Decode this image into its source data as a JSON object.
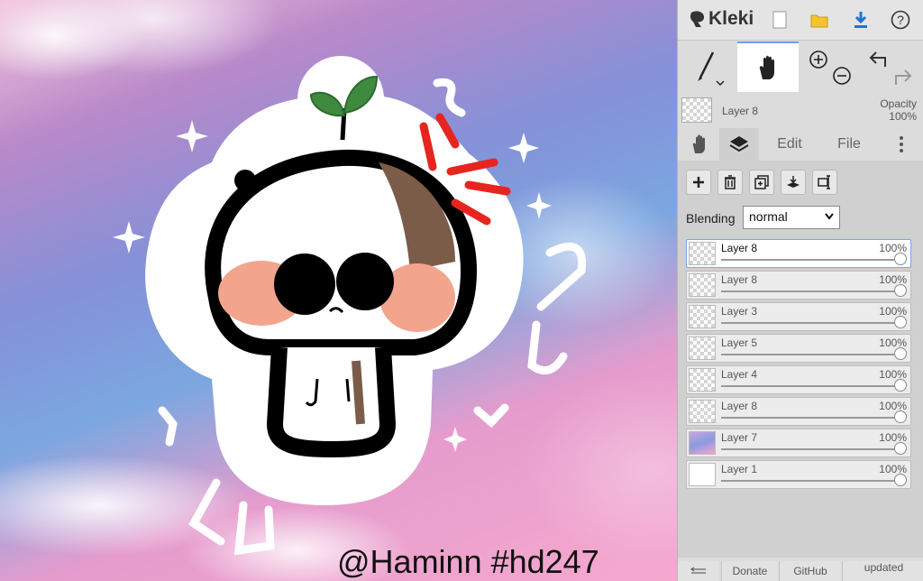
{
  "canvas": {
    "watermark": "@Haminn #hd247"
  },
  "app": {
    "logo_text": "Kleki"
  },
  "topbar": {
    "icons": [
      "new-file-icon",
      "open-folder-icon",
      "download-icon",
      "help-icon"
    ],
    "help_glyph": "?"
  },
  "tools": {
    "brush": "brush-icon",
    "hand": "hand-icon",
    "zoom_in": "zoom-in-icon",
    "zoom_out": "zoom-out-icon",
    "undo": "undo-icon",
    "redo": "redo-icon"
  },
  "current_layer": {
    "name": "Layer 8",
    "opacity_label": "Opacity",
    "opacity_value": "100%"
  },
  "tabs": {
    "hand": "hand-tab-icon",
    "layers": "layers-icon",
    "edit": "Edit",
    "file": "File",
    "more": "more-icon"
  },
  "layer_actions": [
    "add-layer-icon",
    "delete-layer-icon",
    "duplicate-layer-icon",
    "merge-down-icon",
    "rename-layer-icon"
  ],
  "blending": {
    "label": "Blending",
    "value": "normal"
  },
  "layers": [
    {
      "name": "Layer 8",
      "opacity": "100%",
      "selected": true
    },
    {
      "name": "Layer 8",
      "opacity": "100%",
      "selected": false
    },
    {
      "name": "Layer 3",
      "opacity": "100%",
      "selected": false
    },
    {
      "name": "Layer 5",
      "opacity": "100%",
      "selected": false
    },
    {
      "name": "Layer 4",
      "opacity": "100%",
      "selected": false
    },
    {
      "name": "Layer 8",
      "opacity": "100%",
      "selected": false
    },
    {
      "name": "Layer 7",
      "opacity": "100%",
      "selected": false
    },
    {
      "name": "Layer 1",
      "opacity": "100%",
      "selected": false
    }
  ],
  "footer": {
    "back": "collapse-icon",
    "donate": "Donate",
    "github": "GitHub",
    "updated": "updated"
  },
  "colors": {
    "accent": "#6a9fe8",
    "sidebar_bg": "#dcdcdc",
    "panel_bg": "#d0d0d0"
  }
}
